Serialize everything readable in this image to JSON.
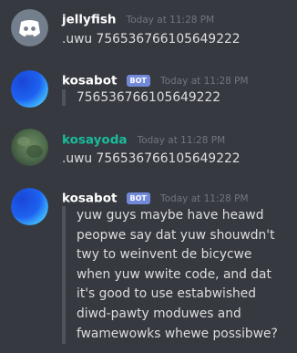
{
  "messages": [
    {
      "username": "jellyfish",
      "timestamp": "Today at 11:28 PM",
      "content": ".uwu 756536766105649222",
      "avatar_icon": "discord-logo-icon",
      "avatar_color": "#747f8d"
    },
    {
      "username": "kosabot",
      "bot_tag": "BOT",
      "timestamp": "Today at 11:28 PM",
      "content": "756536766105649222",
      "avatar_icon": "blue-gradient-avatar",
      "avatar_color": "#1e5ee8"
    },
    {
      "username": "kosayoda",
      "timestamp": "Today at 11:28 PM",
      "content": ".uwu 756536766105649222",
      "avatar_icon": "photo-avatar",
      "avatar_color": "#5a7a55"
    },
    {
      "username": "kosabot",
      "bot_tag": "BOT",
      "timestamp": "Today at 11:28 PM",
      "content": "yuw guys maybe have heawd peopwe say dat yuw shouwdn't twy to weinvent de bicycwe when yuw wwite code, and dat it's good to use estabwished diwd-pawty moduwes and fwamewowks whewe possibwe?",
      "avatar_icon": "blue-gradient-avatar",
      "avatar_color": "#1e5ee8"
    }
  ],
  "colors": {
    "background": "#36393f",
    "username": "#ffffff",
    "username_kosayoda": "#1abc9c",
    "bot_tag": "#7289da",
    "timestamp": "#72767d",
    "text": "#dcddde",
    "quote_bar": "#4f545c"
  }
}
